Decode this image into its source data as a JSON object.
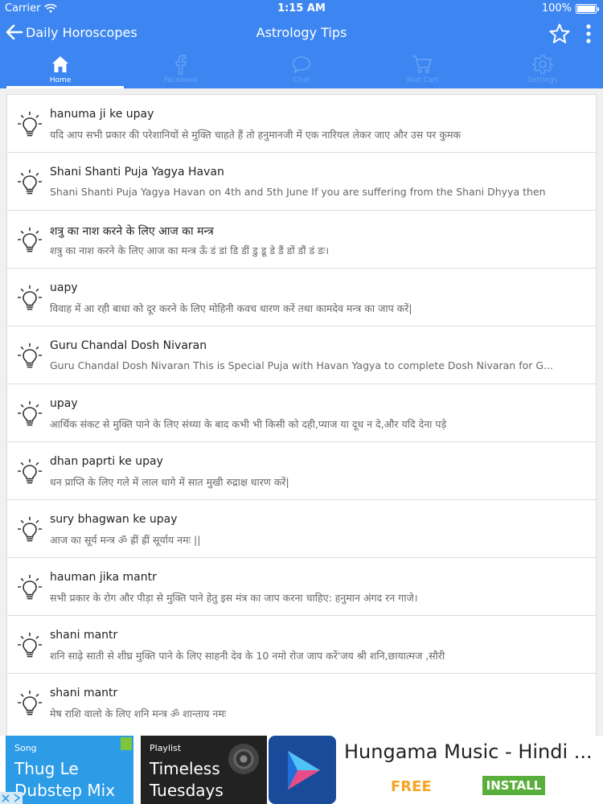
{
  "status": {
    "carrier": "Carrier",
    "time": "1:15 AM",
    "battery": "100%"
  },
  "nav": {
    "back_label": "Daily Horoscopes",
    "title": "Astrology Tips"
  },
  "tabs": [
    {
      "label": "Home",
      "icon": "home-icon",
      "active": true
    },
    {
      "label": "Facebook",
      "icon": "facebook-icon",
      "active": false
    },
    {
      "label": "Chat",
      "icon": "chat-icon",
      "active": false
    },
    {
      "label": "Your Cart",
      "icon": "cart-icon",
      "active": false
    },
    {
      "label": "Settings",
      "icon": "gear-icon",
      "active": false
    }
  ],
  "items": [
    {
      "title": "hanuma ji ke upay",
      "subtitle": "यदि आप सभी प्रकार की परेशानियों से मुक्ति चाहते हैं तो हनुमानजी में एक नारियल लेकर जाए और उस पर कुमक"
    },
    {
      "title": "Shani Shanti Puja Yagya Havan",
      "subtitle": " Shani Shanti Puja Yagya Havan on 4th and 5th June If you are suffering from the Shani Dhyya then"
    },
    {
      "title": "शत्रु का नाश करने के लिए आज का मन्त्र",
      "subtitle": "शत्रु का नाश करने के लिए आज का मन्त्र ऊँ डं डां डि डीं डु डू डे डैं डों डौं डं डः।"
    },
    {
      "title": "uapy",
      "subtitle": "विवाह में आ रही बाधा को दूर करने के लिए मोहिनी कवच धारण करें तथा  कामदेव मन्त्र का जाप करें|"
    },
    {
      "title": "Guru Chandal Dosh Nivaran",
      "subtitle": "Guru Chandal Dosh Nivaran This is Special Puja with Havan Yagya  to complete Dosh Nivaran for G..."
    },
    {
      "title": "upay",
      "subtitle": "आर्थिक संकट से मुक्ति पाने के लिए संध्या के बाद कभी भी किसी को दही,प्याज या दूध न दे,और यदि देना पड़े"
    },
    {
      "title": "dhan paprti ke upay",
      "subtitle": "धन प्राप्ति के लिए गले में लाल धागे में सात मुखी रुद्राक्ष धारण करें|"
    },
    {
      "title": "sury bhagwan ke upay",
      "subtitle": "आज का सूर्य मन्त्र  ॐ ह्रीं ह्रीं सूर्याय नमः ||"
    },
    {
      "title": "hauman jika mantr",
      "subtitle": "सभी प्रकार के रोग और पीड़ा से मुक्ति पाने हेतु इस मंत्र का जाप करना चाहिए:  हनुमान अंगद रन गाजे।"
    },
    {
      "title": "shani mantr",
      "subtitle": "शनि साढ़े साती से शीघ्र मुक्ति पाने के लिए साहनी देव के 10 नमो रोज जाप करें'जय श्री शनि,छायात्मज ,सौरी"
    },
    {
      "title": "shani mantr",
      "subtitle": "मेष राशि वालो के लिए शनि मन्त्र ॐ शान्ताय नमः"
    }
  ],
  "ad": {
    "tile1": {
      "tag": "Song",
      "title_line1": "Thug Le",
      "title_line2": "Dubstep Mix"
    },
    "tile2": {
      "tag": "Playlist",
      "title_line1": "Timeless",
      "title_line2": "Tuesdays"
    },
    "app_name": "Hungama Music - Hindi ...",
    "price": "FREE",
    "install_label": "INSTALL"
  },
  "colors": {
    "bar": "#3d86f2",
    "tab_inactive": "#6aa3f5",
    "free": "#f5a623",
    "install": "#5aaf3c"
  }
}
